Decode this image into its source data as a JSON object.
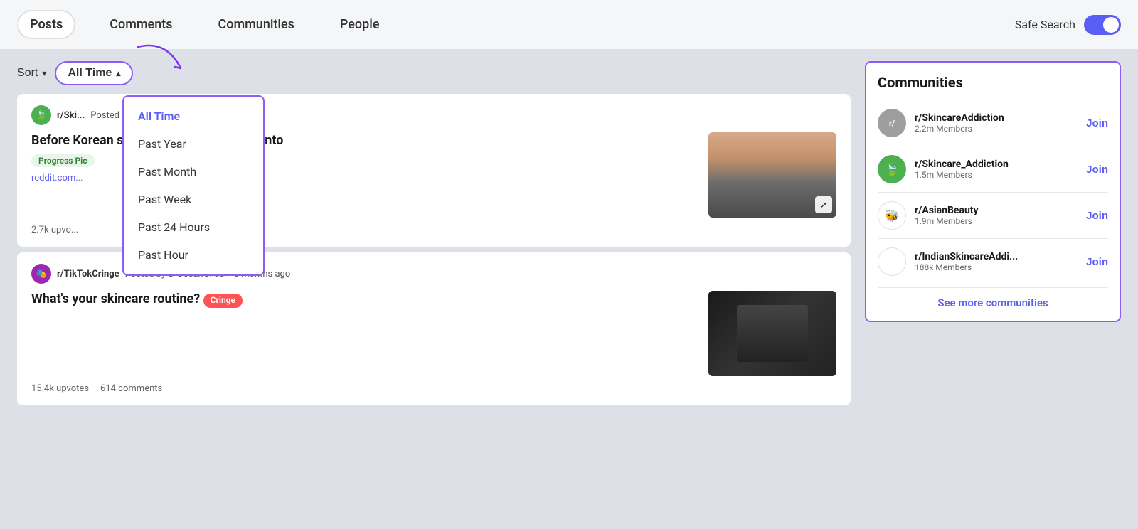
{
  "nav": {
    "tabs": [
      {
        "id": "posts",
        "label": "Posts",
        "active": true
      },
      {
        "id": "comments",
        "label": "Comments",
        "active": false
      },
      {
        "id": "communities",
        "label": "Communities",
        "active": false
      },
      {
        "id": "people",
        "label": "People",
        "active": false
      }
    ],
    "safe_search_label": "Safe Search",
    "safe_search_on": true
  },
  "sort": {
    "label": "Sort",
    "time_label": "All Time",
    "dropdown_items": [
      {
        "id": "all-time",
        "label": "All Time",
        "selected": true
      },
      {
        "id": "past-year",
        "label": "Past Year",
        "selected": false
      },
      {
        "id": "past-month",
        "label": "Past Month",
        "selected": false
      },
      {
        "id": "past-week",
        "label": "Past Week",
        "selected": false
      },
      {
        "id": "past-24-hours",
        "label": "Past 24 Hours",
        "selected": false
      },
      {
        "id": "past-hour",
        "label": "Past Hour",
        "selected": false
      }
    ]
  },
  "posts": [
    {
      "id": "post-1",
      "subreddit": "r/Ski...",
      "subreddit_icon": "🍃",
      "subreddit_type": "green",
      "meta": "Posted by u/wordsbymul  11 months ago",
      "title": "Before Korean skincare vs After getting into",
      "tag": "Progress Pic",
      "link": "reddit.com...",
      "upvotes": "2.7k upvo...",
      "comments": ""
    },
    {
      "id": "post-2",
      "subreddit": "r/TikTokCringe",
      "subreddit_icon": "🎭",
      "subreddit_type": "tiktok",
      "meta": "Posted by u/OceanGlider_  6 months ago",
      "title": "What's your skincare routine?",
      "tag": "Cringe",
      "tag_type": "cringe",
      "link": "",
      "upvotes": "15.4k upvotes",
      "comments": "614 comments"
    }
  ],
  "communities": {
    "title": "Communities",
    "items": [
      {
        "id": "skincare-addiction",
        "name": "r/SkincareAddiction",
        "members": "2.2m Members",
        "icon_type": "grey",
        "icon_text": "r/"
      },
      {
        "id": "skincare-addiction-2",
        "name": "r/Skincare_Addiction",
        "members": "1.5m Members",
        "icon_type": "green",
        "icon_text": "🍃"
      },
      {
        "id": "asian-beauty",
        "name": "r/AsianBeauty",
        "members": "1.9m Members",
        "icon_type": "bee",
        "icon_text": "🐝"
      },
      {
        "id": "indian-skincare",
        "name": "r/IndianSkincareAddi...",
        "members": "188k Members",
        "icon_type": "atom",
        "icon_text": "⚛"
      }
    ],
    "see_more_label": "See more communities",
    "join_label": "Join"
  }
}
